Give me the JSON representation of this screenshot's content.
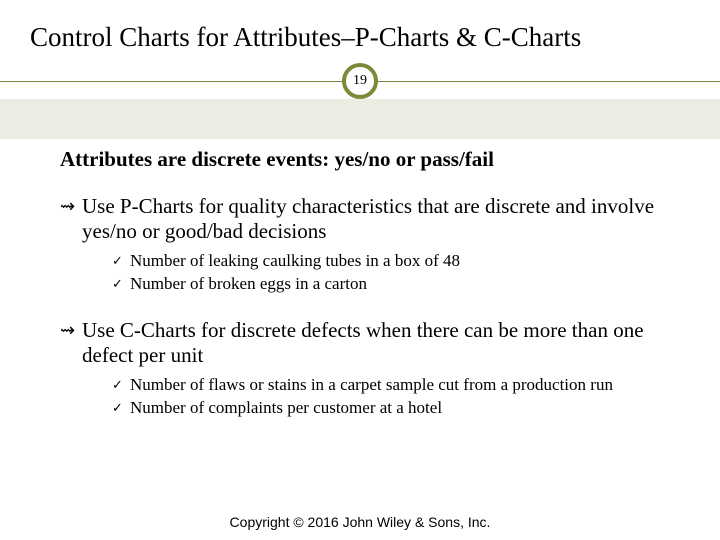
{
  "title": "Control Charts for Attributes–P-Charts & C-Charts",
  "page_number": "19",
  "intro": "Attributes are discrete events: yes/no or pass/fail",
  "points": [
    {
      "text": "Use P-Charts for quality characteristics that are discrete and involve yes/no or good/bad decisions",
      "subs": [
        "Number of leaking caulking tubes in a box of 48",
        "Number of broken eggs in a carton"
      ]
    },
    {
      "text": "Use C-Charts for discrete defects when there can be more than one defect per unit",
      "subs": [
        "Number of flaws or stains in a carpet sample cut from a production run",
        "Number of complaints per customer at a hotel"
      ]
    }
  ],
  "footer": "Copyright © 2016 John Wiley & Sons, Inc."
}
